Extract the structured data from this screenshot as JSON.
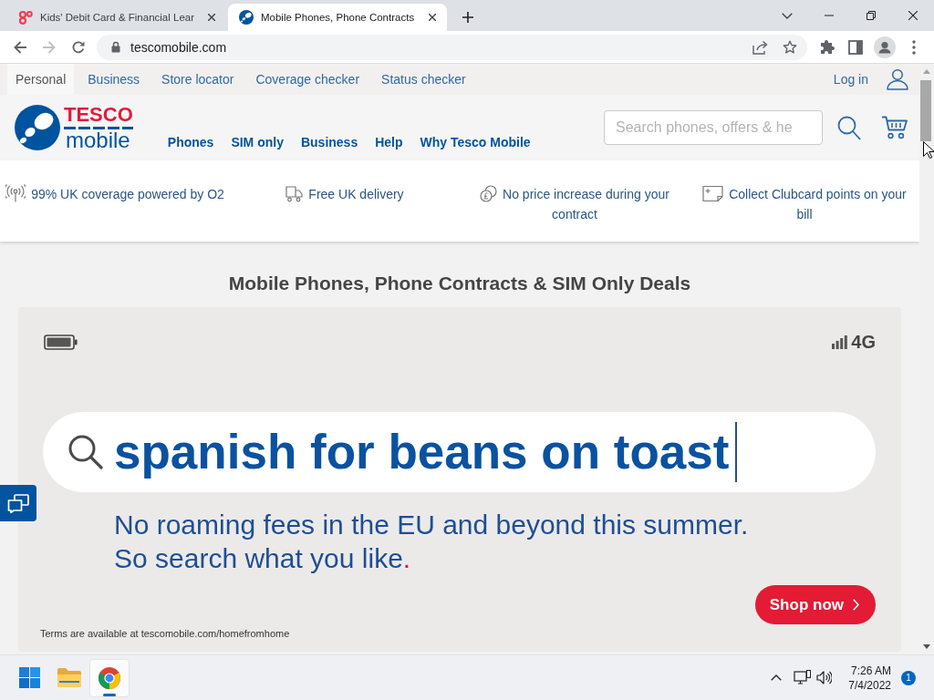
{
  "browser": {
    "tabs": [
      {
        "kind": "loops",
        "title": "Kids' Debit Card & Financial Lear",
        "selected": false
      },
      {
        "kind": "logo",
        "title": "Mobile Phones, Phone Contracts",
        "selected": true
      }
    ],
    "nav_buttons": [
      {
        "kind": "back",
        "disabled": false
      },
      {
        "kind": "forward",
        "disabled": true
      },
      {
        "kind": "reload",
        "disabled": false
      }
    ],
    "address": "tescomobile.com"
  },
  "utility_nav": {
    "items": [
      {
        "label": "Personal",
        "selected": true
      },
      {
        "label": "Business",
        "selected": false
      },
      {
        "label": "Store locator",
        "selected": false
      },
      {
        "label": "Coverage checker",
        "selected": false
      },
      {
        "label": "Status checker",
        "selected": false
      }
    ],
    "login": "Log in"
  },
  "header": {
    "logo": {
      "brand": "TESCO",
      "product": "mobile"
    },
    "nav": [
      "Phones",
      "SIM only",
      "Business",
      "Help",
      "Why Tesco Mobile"
    ],
    "search": {
      "placeholder": "Search phones, offers & he"
    }
  },
  "benefits": [
    {
      "kind": "signal",
      "text": "99% UK coverage powered by O2"
    },
    {
      "kind": "delivery",
      "text": "Free UK delivery"
    },
    {
      "kind": "price",
      "text": "No price increase during your contract"
    },
    {
      "kind": "clubcard",
      "text": "Collect Clubcard points on your bill"
    }
  ],
  "page_title": "Mobile Phones, Phone Contracts & SIM Only Deals",
  "banner": {
    "network": "4G",
    "search_text": "spanish for beans on toast",
    "lines": [
      "No roaming fees in the EU and beyond this summer.",
      "So search what you like"
    ],
    "end_mark": ".",
    "button": "Shop now",
    "terms": "Terms are available at tescomobile.com/homefromhome"
  },
  "taskbar": {
    "apps": [
      {
        "kind": "start",
        "active": false
      },
      {
        "kind": "explorer",
        "active": false
      },
      {
        "kind": "browser",
        "active": true
      }
    ],
    "time": "7:26 AM",
    "date": "7/4/2022",
    "notifications": "1"
  }
}
